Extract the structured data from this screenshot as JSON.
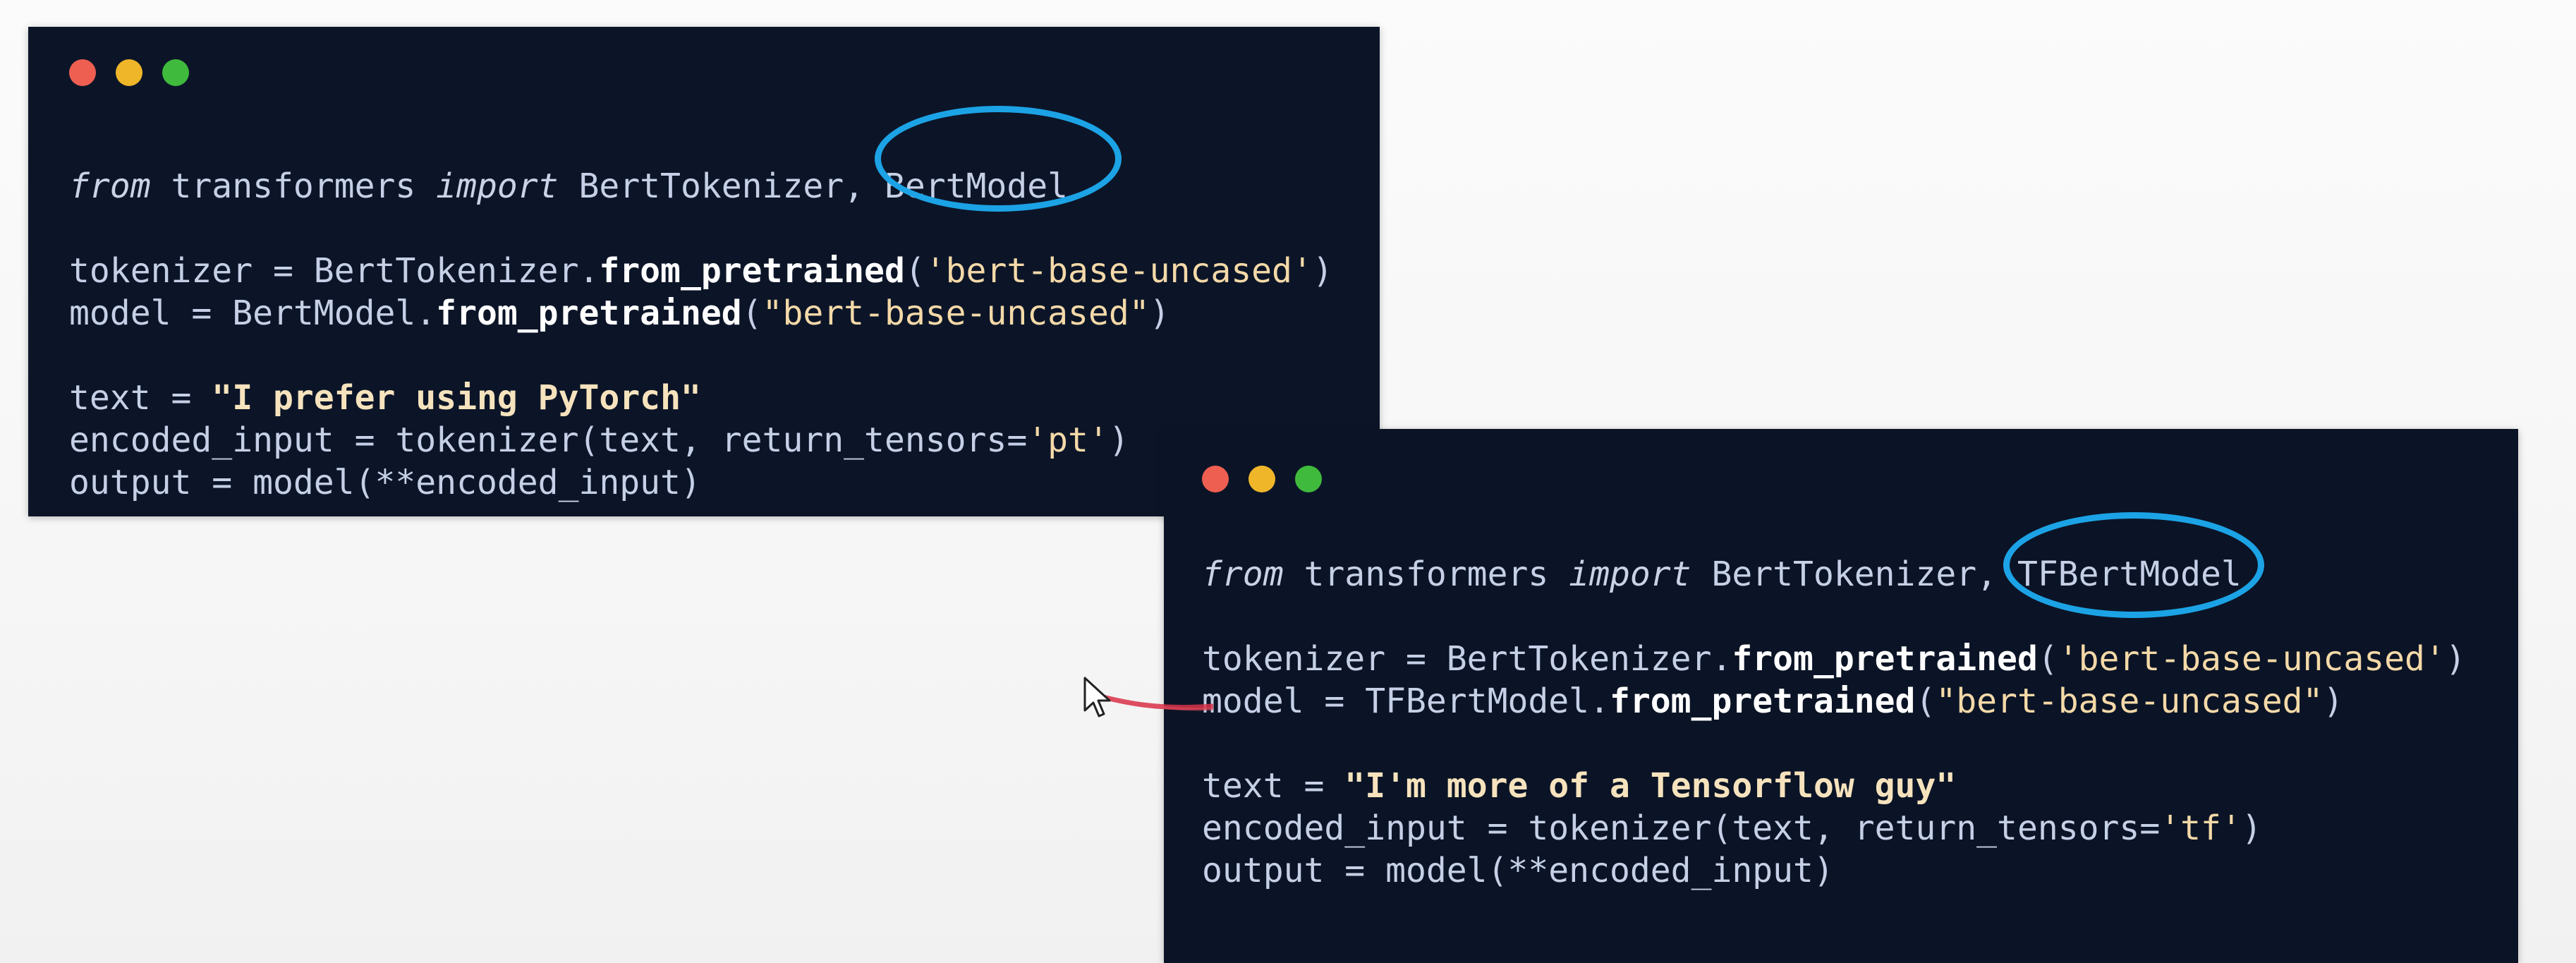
{
  "window_pytorch": {
    "lines": [
      {
        "kw1": "from",
        "mod": " transformers ",
        "kw2": "import",
        "names": " BertTokenizer, ",
        "hl": "BertModel"
      },
      {
        "blank": true
      },
      {
        "lhs": "tokenizer = BertTokenizer.",
        "fn": "from_pretrained",
        "open": "(",
        "arg": "'bert-base-uncased'",
        "close": ")"
      },
      {
        "lhs": "model = BertModel.",
        "fn": "from_pretrained",
        "open": "(",
        "arg": "\"bert-base-uncased\"",
        "close": ")"
      },
      {
        "blank": true
      },
      {
        "lhs": "text = ",
        "strbold": "\"I prefer using PyTorch\""
      },
      {
        "lhs": "encoded_input = tokenizer(text, return_tensors=",
        "arg": "'pt'",
        "close": ")"
      },
      {
        "lhs": "output = model(**encoded_input)"
      }
    ]
  },
  "window_tf": {
    "lines": [
      {
        "kw1": "from",
        "mod": " transformers ",
        "kw2": "import",
        "names": " BertTokenizer, ",
        "hl": "TFBertModel"
      },
      {
        "blank": true
      },
      {
        "lhs": "tokenizer = BertTokenizer.",
        "fn": "from_pretrained",
        "open": "(",
        "arg": "'bert-base-uncased'",
        "close": ")"
      },
      {
        "lhs": "model = TFBertModel.",
        "fn": "from_pretrained",
        "open": "(",
        "arg": "\"bert-base-uncased\"",
        "close": ")"
      },
      {
        "blank": true
      },
      {
        "lhs": "text = ",
        "strbold": "\"I'm more of a Tensorflow guy\""
      },
      {
        "lhs": "encoded_input = tokenizer(text, return_tensors=",
        "arg": "'tf'",
        "close": ")"
      },
      {
        "lhs": "output = model(**encoded_input)"
      }
    ]
  },
  "colors": {
    "window_bg": "#0c1528",
    "code_text": "#c5d0e6",
    "string": "#f4d9a8",
    "highlight_ring": "#1ca3e6",
    "annotation_stroke": "#d8324a",
    "dot_red": "#ef5f51",
    "dot_yellow": "#f0b62a",
    "dot_green": "#3fba3d"
  },
  "icons": {
    "window_controls": [
      "close-dot",
      "minimize-dot",
      "maximize-dot"
    ],
    "pointer": "mouse-pointer-icon"
  }
}
